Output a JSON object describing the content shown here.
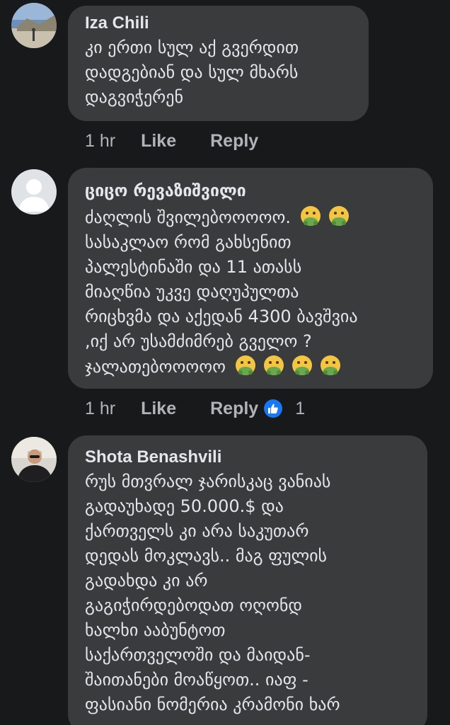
{
  "comments": [
    {
      "author": "Iza Chili",
      "text": "კი ერთი სულ აქ გვერდით\nდადგებიან და სულ მხარს\nდაგვიჭერენ",
      "time": "1 hr",
      "like_label": "Like",
      "reply_label": "Reply"
    },
    {
      "author": "ციცო რევაზიშვილი",
      "text_line1": "ძაღლის შვილებოოოოო.",
      "text_middle": "სასაკლაო რომ გახსენით\nპალესტინაში და 11 ათასს\nმიაღწია უკვე დაღუპულთა\nრიცხვმა და აქედან 4300 ბავშვია\n,იქ არ უსამძიმრებ გველო ?",
      "text_last": "ჯალათებოოოოო",
      "emoji_name": "nauseated-face-icon",
      "time": "1 hr",
      "like_label": "Like",
      "reply_label": "Reply",
      "reaction_count": "1"
    },
    {
      "author": "Shota Benashvili",
      "text": "რუს მთვრალ ჯარისკაც ვანიას\nგადაუხადე 50.000.$ და\nქართველს კი არა საკუთარ\nდედას მოკლავს.. მაგ ფულის\nგადახდა კი არ\nგაგიჭირდებოდათ ოღონდ\nხალხი ააბუნტოთ\nსაქართველოში და მაიდან-\nშაითანები მოაწყოთ.. იაფ -\nფასიანი ნომერია კრამონი ხარ"
    }
  ],
  "colors": {
    "background": "#18191a",
    "bubble": "#3a3b3c",
    "text": "#e4e6eb",
    "secondary": "#b0b3b8",
    "like_badge": "#1877f2"
  }
}
